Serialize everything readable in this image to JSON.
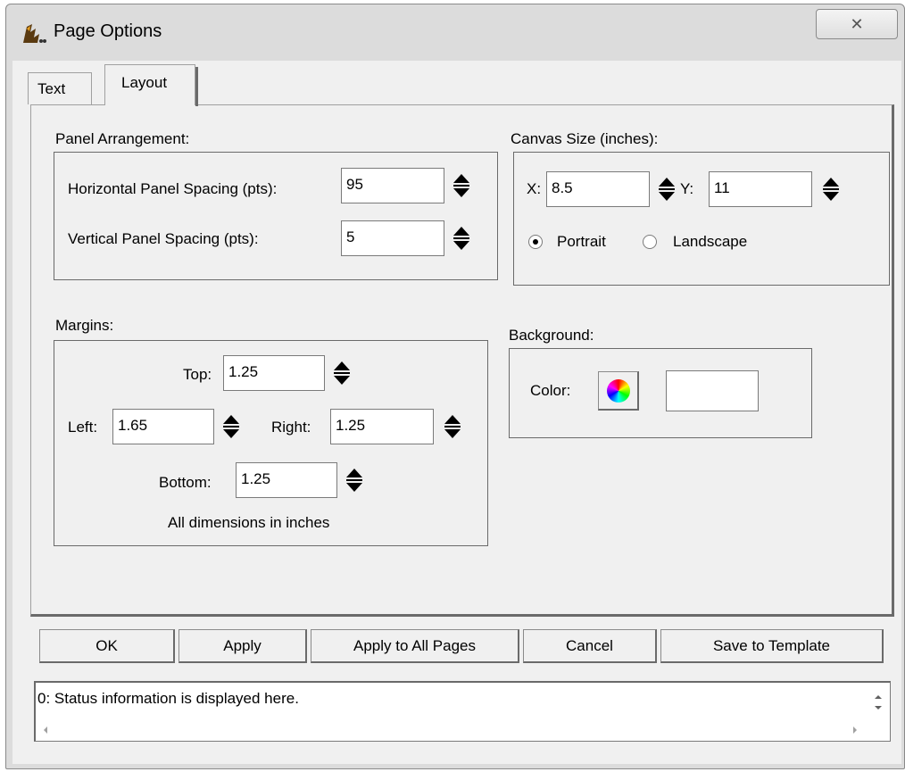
{
  "window": {
    "title": "Page Options",
    "close_glyph": "✕"
  },
  "tabs": [
    {
      "label": "Text"
    },
    {
      "label": "Layout"
    }
  ],
  "panel_arrangement": {
    "title": "Panel Arrangement:",
    "horizontal_label": "Horizontal Panel Spacing (pts):",
    "horizontal_value": "95",
    "vertical_label": "Vertical Panel Spacing (pts):",
    "vertical_value": "5"
  },
  "canvas": {
    "title": "Canvas Size (inches):",
    "x_label": "X:",
    "x_value": "8.5",
    "y_label": "Y:",
    "y_value": "11",
    "portrait_label": "Portrait",
    "landscape_label": "Landscape",
    "orientation": "Portrait"
  },
  "margins": {
    "title": "Margins:",
    "top_label": "Top:",
    "top_value": "1.25",
    "left_label": "Left:",
    "left_value": "1.65",
    "right_label": "Right:",
    "right_value": "1.25",
    "bottom_label": "Bottom:",
    "bottom_value": "1.25",
    "note": "All dimensions in inches"
  },
  "background": {
    "title": "Background:",
    "color_label": "Color:",
    "color_value": "#ffffff"
  },
  "buttons": {
    "ok": "OK",
    "apply": "Apply",
    "apply_all": "Apply to All Pages",
    "cancel": "Cancel",
    "save_template": "Save to Template"
  },
  "status": {
    "text": "0: Status information is displayed here."
  }
}
